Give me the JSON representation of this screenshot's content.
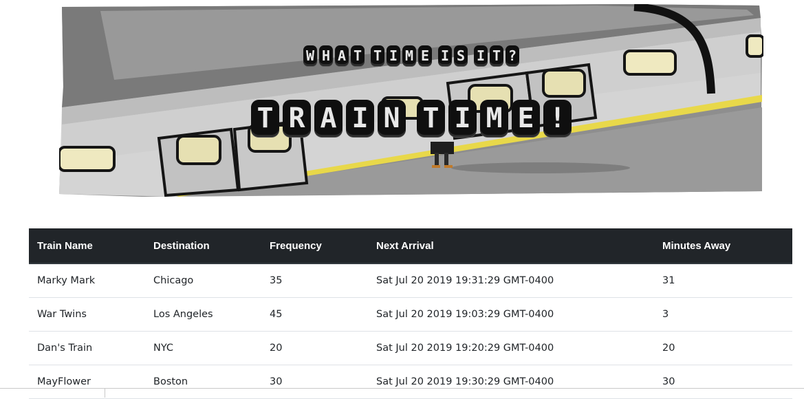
{
  "header": {
    "subtitle": "WHAT TIME IS IT?",
    "title": "TRAIN TIME!"
  },
  "table": {
    "columns": [
      "Train Name",
      "Destination",
      "Frequency",
      "Next Arrival",
      "Minutes Away"
    ],
    "rows": [
      [
        "Marky Mark",
        "Chicago",
        "35",
        "Sat Jul 20 2019 19:31:29 GMT-0400",
        "31"
      ],
      [
        "War Twins",
        "Los Angeles",
        "45",
        "Sat Jul 20 2019 19:03:29 GMT-0400",
        "3"
      ],
      [
        "Dan's Train",
        "NYC",
        "20",
        "Sat Jul 20 2019 19:20:29 GMT-0400",
        "20"
      ],
      [
        "MayFlower",
        "Boston",
        "30",
        "Sat Jul 20 2019 19:30:29 GMT-0400",
        "30"
      ]
    ]
  },
  "colors": {
    "table_header_bg": "#212529",
    "row_divider": "#dee2e6",
    "platform_line": "#e8d84a"
  },
  "icons": {
    "hero": "train-illustration"
  }
}
